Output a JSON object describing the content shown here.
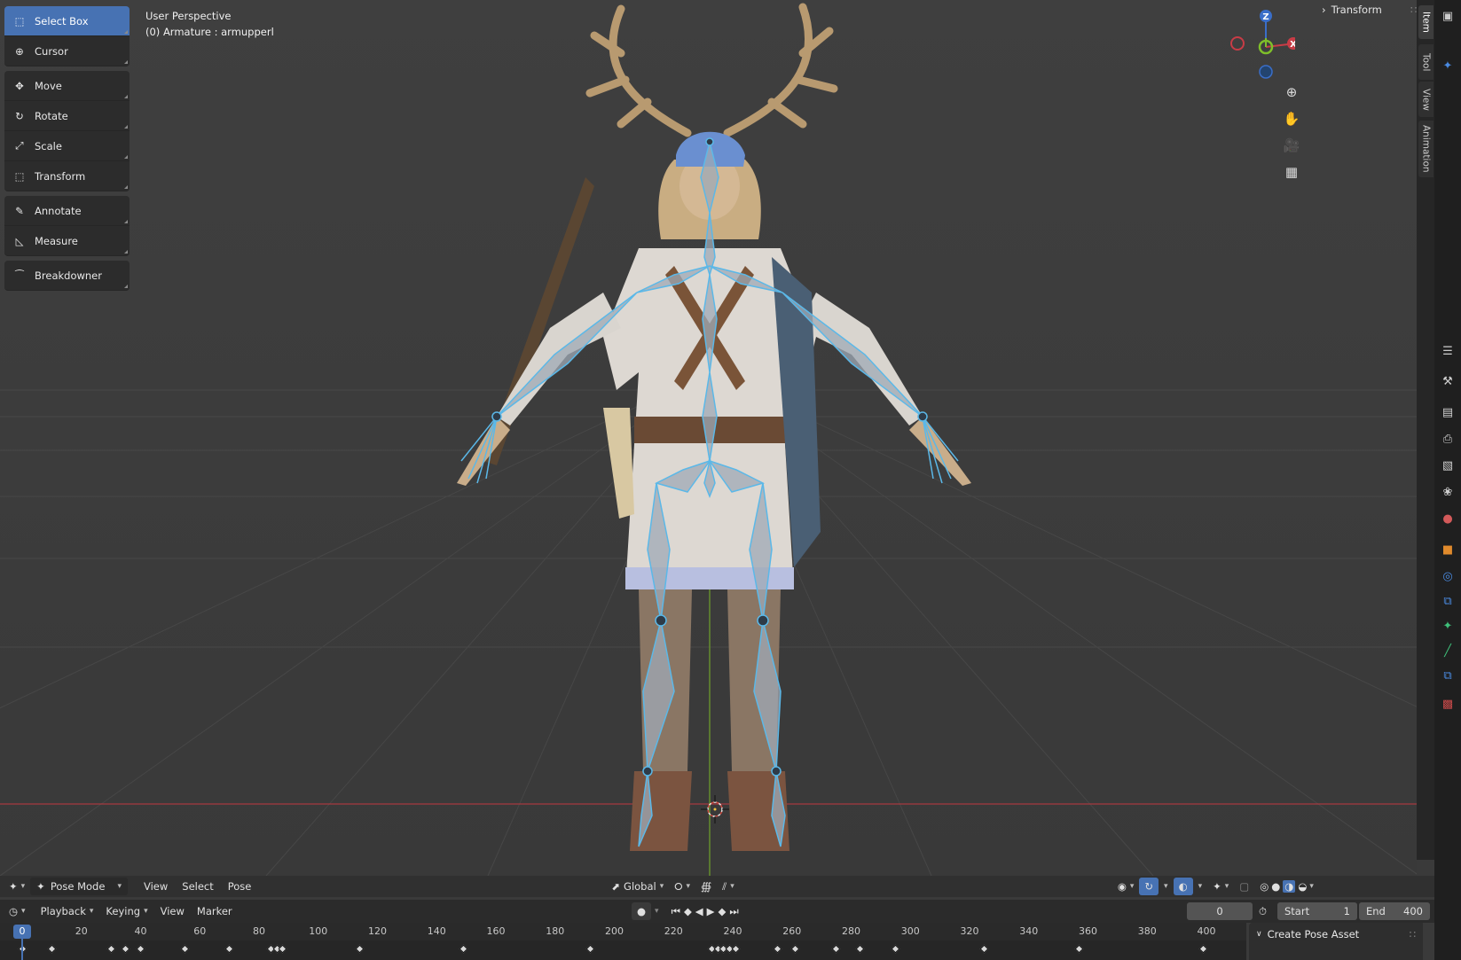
{
  "viewport": {
    "title": "User Perspective",
    "subtitle": "(0) Armature : armupperl"
  },
  "toolbar": {
    "groups": [
      [
        {
          "label": "Select Box",
          "icon": "select-box-icon",
          "active": true
        },
        {
          "label": "Cursor",
          "icon": "cursor-icon",
          "active": false
        }
      ],
      [
        {
          "label": "Move",
          "icon": "move-icon",
          "active": false
        },
        {
          "label": "Rotate",
          "icon": "rotate-icon",
          "active": false
        },
        {
          "label": "Scale",
          "icon": "scale-icon",
          "active": false
        },
        {
          "label": "Transform",
          "icon": "transform-icon",
          "active": false
        }
      ],
      [
        {
          "label": "Annotate",
          "icon": "annotate-icon",
          "active": false
        },
        {
          "label": "Measure",
          "icon": "measure-icon",
          "active": false
        }
      ],
      [
        {
          "label": "Breakdowner",
          "icon": "breakdowner-icon",
          "active": false
        }
      ]
    ]
  },
  "gizmo": {
    "z": "Z",
    "x": "X"
  },
  "npanel": {
    "header": "Transform",
    "tabs": [
      "Item",
      "Tool",
      "View",
      "Animation"
    ]
  },
  "header_bar": {
    "mode": "Pose Mode",
    "menus": [
      "View",
      "Select",
      "Pose"
    ],
    "orientation": "Global"
  },
  "timeline": {
    "menus": [
      "Playback",
      "Keying",
      "View",
      "Marker"
    ],
    "current_frame": "0",
    "start_label": "Start",
    "start_value": "1",
    "end_label": "End",
    "end_value": "400",
    "ticks": [
      "0",
      "20",
      "40",
      "60",
      "80",
      "100",
      "120",
      "140",
      "160",
      "180",
      "200",
      "220",
      "240",
      "260",
      "280",
      "300",
      "320",
      "340",
      "360",
      "380",
      "400"
    ],
    "keyframes": [
      0,
      10,
      30,
      35,
      40,
      55,
      70,
      84,
      86,
      88,
      114,
      149,
      192,
      233,
      235,
      237,
      239,
      241,
      255,
      261,
      275,
      283,
      295,
      325,
      357,
      399
    ]
  },
  "pose_panel": {
    "title": "Create Pose Asset"
  },
  "colors": {
    "accent": "#4772b3",
    "bone": "#5bb8e8",
    "axis_x": "#c83c46",
    "axis_y": "#7fbf2a",
    "axis_z": "#3a6ec9"
  }
}
